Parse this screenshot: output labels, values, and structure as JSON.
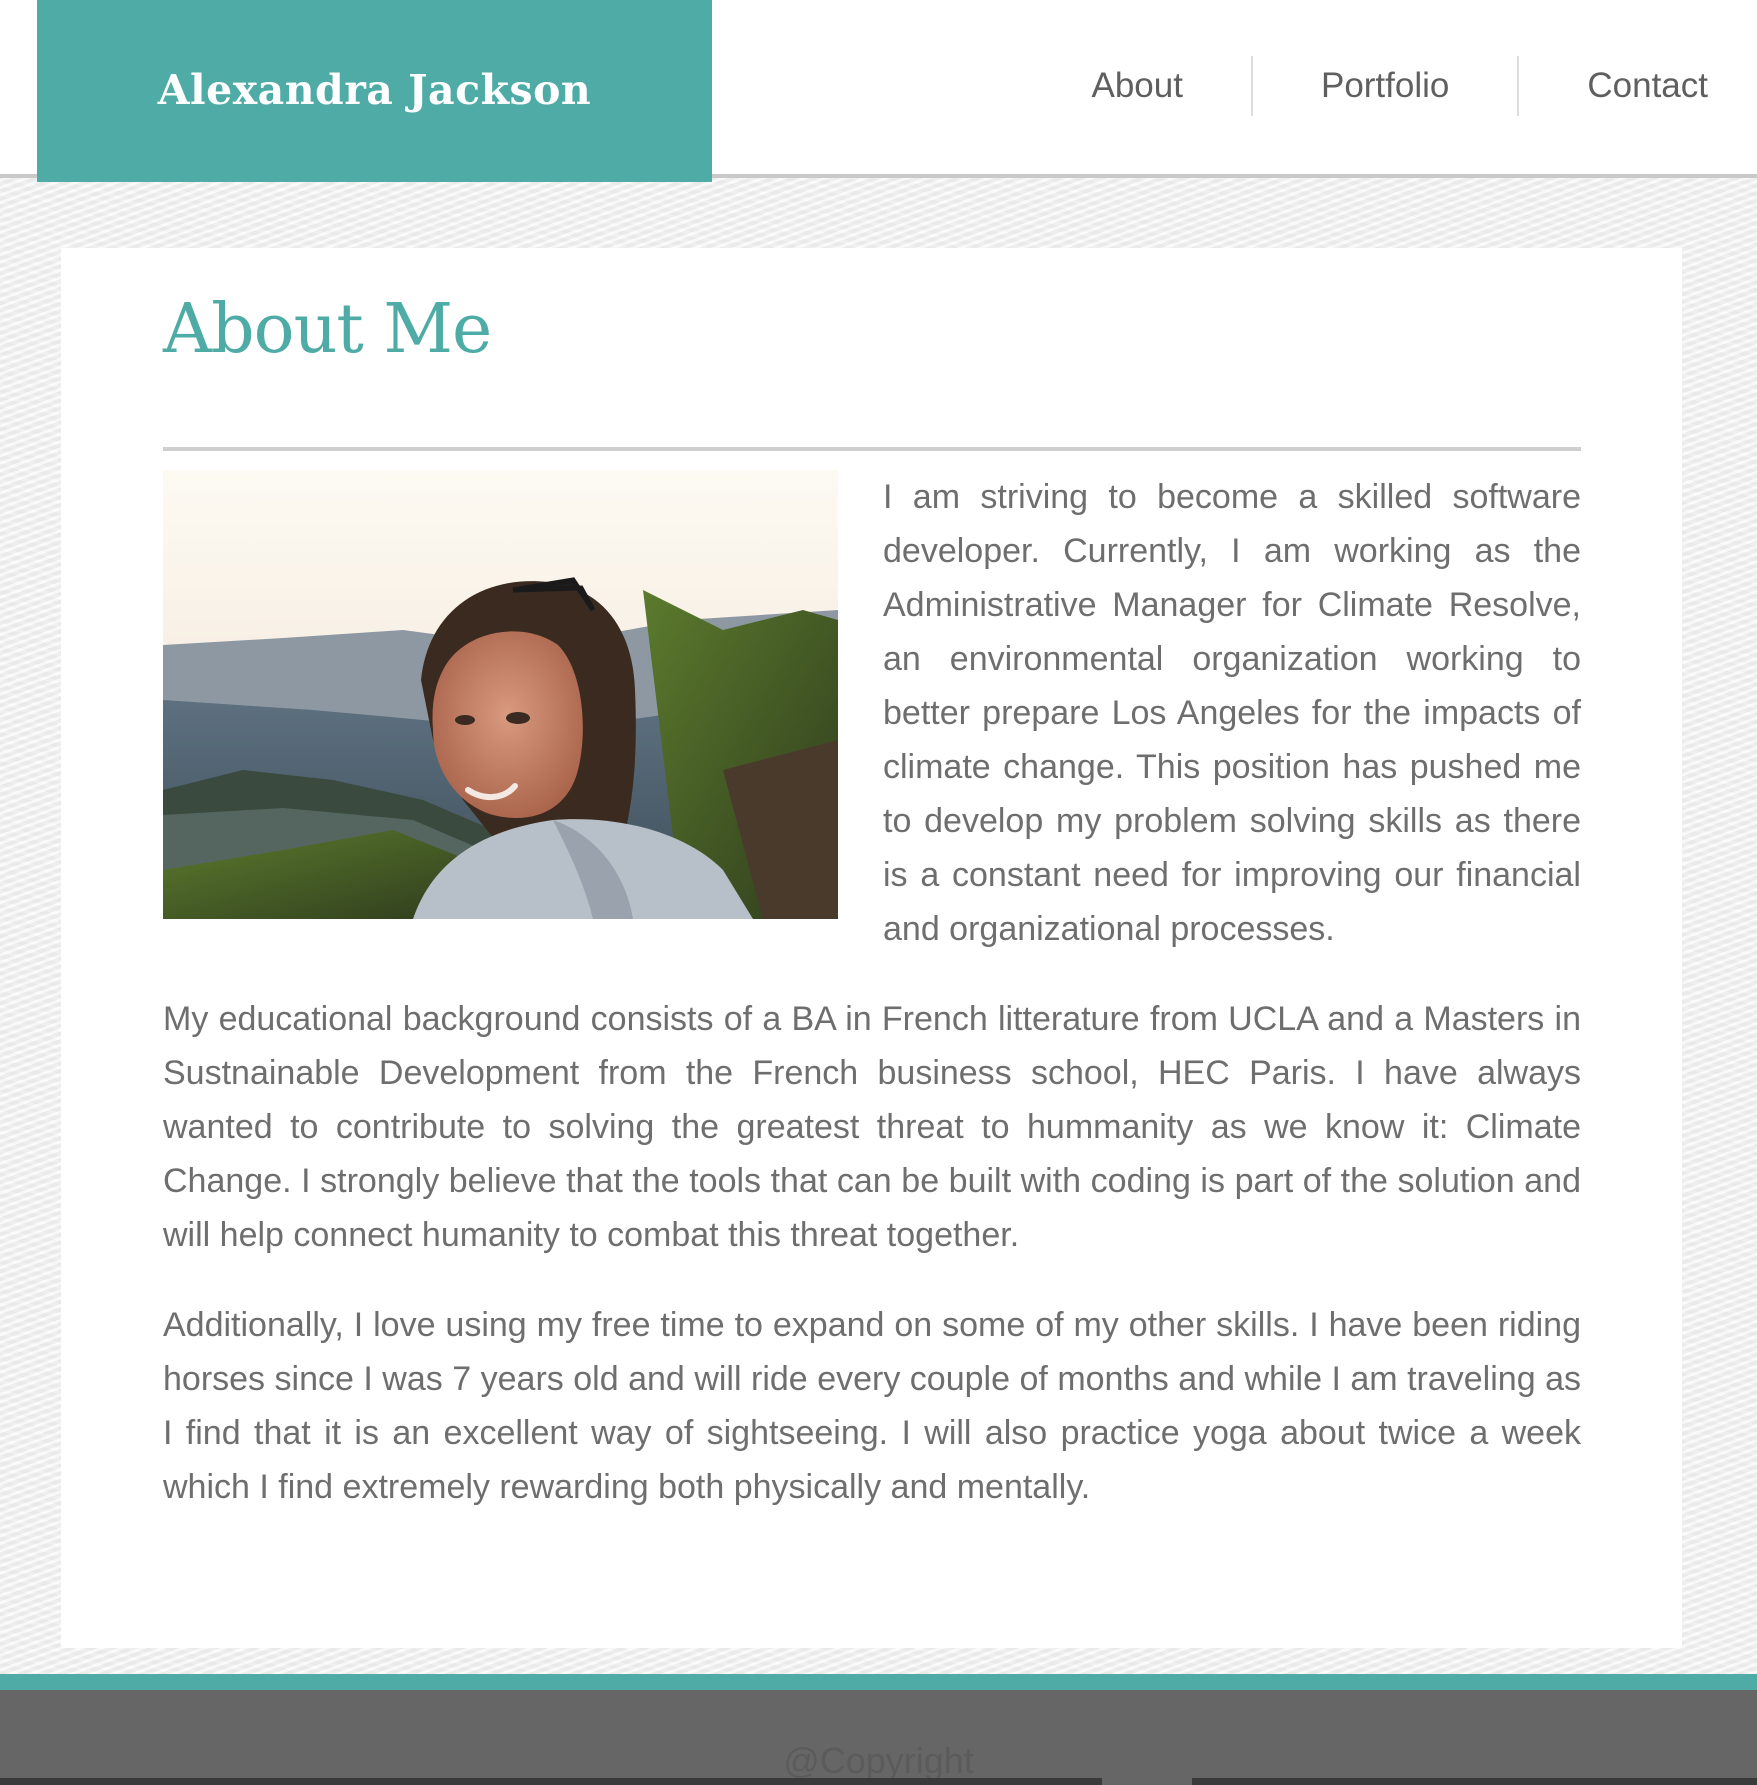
{
  "header": {
    "brand_name": "Alexandra Jackson",
    "nav": [
      {
        "label": "About"
      },
      {
        "label": "Portfolio"
      },
      {
        "label": "Contact"
      }
    ]
  },
  "main": {
    "title": "About Me",
    "photo_alt": "Portrait of Alexandra Jackson on a hillside at sunset",
    "paragraphs": [
      "I am striving to become a skilled software developer. Currently, I am working as the Administrative Manager for Climate Resolve, an environmental organization working to better prepare Los Angeles for the impacts of climate change. This position has pushed me to develop my problem solving skills as there is a constant need for improving our financial and organizational processes.",
      "My educational background consists of a BA in French litterature from UCLA and a Masters in Sustnainable Development from the French business school, HEC Paris. I have always wanted to contribute to solving the greatest threat to hummanity as we know it: Climate Change. I strongly believe that the tools that can be built with coding is part of the solution and will help connect humanity to combat this threat together.",
      "Additionally, I love using my free time to expand on some of my other skills. I have been riding horses since I was 7 years old and will ride every couple of months and while I am traveling as I find that it is an excellent way of sightseeing. I will also practice yoga about twice a week which I find extremely rewarding both physically and mentally."
    ]
  },
  "footer": {
    "copyright": "@Copyright"
  },
  "colors": {
    "accent": "#4eaba5",
    "text": "#6e6e6e",
    "footer": "#666666"
  }
}
